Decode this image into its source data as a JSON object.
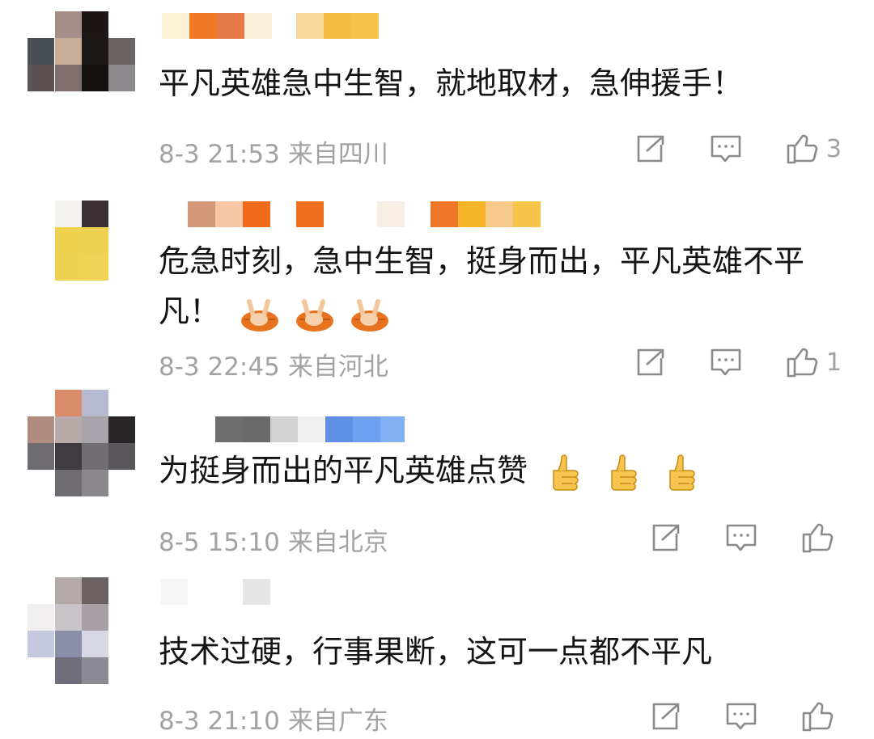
{
  "comments": [
    {
      "text": "平凡英雄急中生智，就地取材，急伸援手！",
      "date": "8-3 21:53",
      "location": "来自四川",
      "likes": "3"
    },
    {
      "text": "危急时刻，急中生智，挺身而出，平凡英雄不平凡！",
      "date": "8-3 22:45",
      "location": "来自河北",
      "likes": "1",
      "emoji": [
        "victory-hand-icon",
        "victory-hand-icon",
        "victory-hand-icon"
      ]
    },
    {
      "text": "为挺身而出的平凡英雄点赞",
      "date": "8-5 15:10",
      "location": "来自北京",
      "likes": "",
      "emoji": [
        "thumbs-up-icon",
        "thumbs-up-icon",
        "thumbs-up-icon"
      ]
    },
    {
      "text": "技术过硬，行事果断，这可一点都不平凡",
      "date": "8-3 21:10",
      "location": "来自广东",
      "likes": ""
    }
  ],
  "icons": {
    "repost": "repost-icon",
    "reply": "comment-icon",
    "like": "thumbs-up-icon"
  },
  "colors": {
    "text": "#141414",
    "meta": "#a2a2a2",
    "icon": "#8a8a8a"
  }
}
